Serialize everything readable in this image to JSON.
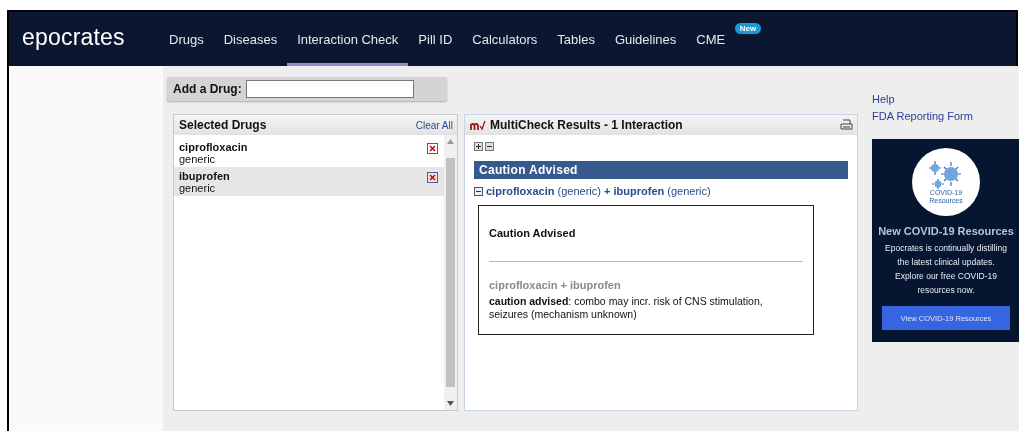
{
  "header": {
    "logo": "epocrates",
    "nav": [
      {
        "label": "Drugs",
        "selected": false
      },
      {
        "label": "Diseases",
        "selected": false
      },
      {
        "label": "Interaction Check",
        "selected": true
      },
      {
        "label": "Pill ID",
        "selected": false
      },
      {
        "label": "Calculators",
        "selected": false
      },
      {
        "label": "Tables",
        "selected": false
      },
      {
        "label": "Guidelines",
        "selected": false
      },
      {
        "label": "CME",
        "selected": false,
        "badge": "New"
      }
    ]
  },
  "add_drug": {
    "label": "Add a Drug:"
  },
  "selected_drugs": {
    "title": "Selected Drugs",
    "clear_all": "Clear All",
    "drugs": [
      {
        "name": "ciprofloxacin",
        "type": "generic",
        "selected": false
      },
      {
        "name": "ibuprofen",
        "type": "generic",
        "selected": true
      }
    ]
  },
  "results": {
    "title": "MultiCheck Results - 1 Interaction",
    "severity": "Caution Advised",
    "interaction": {
      "drug_a": "ciprofloxacin",
      "type_a": "(generic)",
      "plus": "+",
      "drug_b": "ibuprofen",
      "type_b": "(generic)",
      "expanded": true
    },
    "detail": {
      "title": "Caution Advised",
      "pair": "ciprofloxacin + ibuprofen",
      "text": "**caution advised**: combo may incr. risk of CNS stimulation, seizures (mechanism unknown)"
    }
  },
  "sidebar": {
    "links": [
      "Help",
      "FDA Reporting Form"
    ],
    "promo": {
      "image_caption": "COVID-19 Resources",
      "title": "New COVID-19 Resources",
      "text": "Epocrates is continually distilling the latest clinical updates. Explore our free COVID-19 resources now.",
      "button": "View COVID-19 Resources"
    }
  }
}
